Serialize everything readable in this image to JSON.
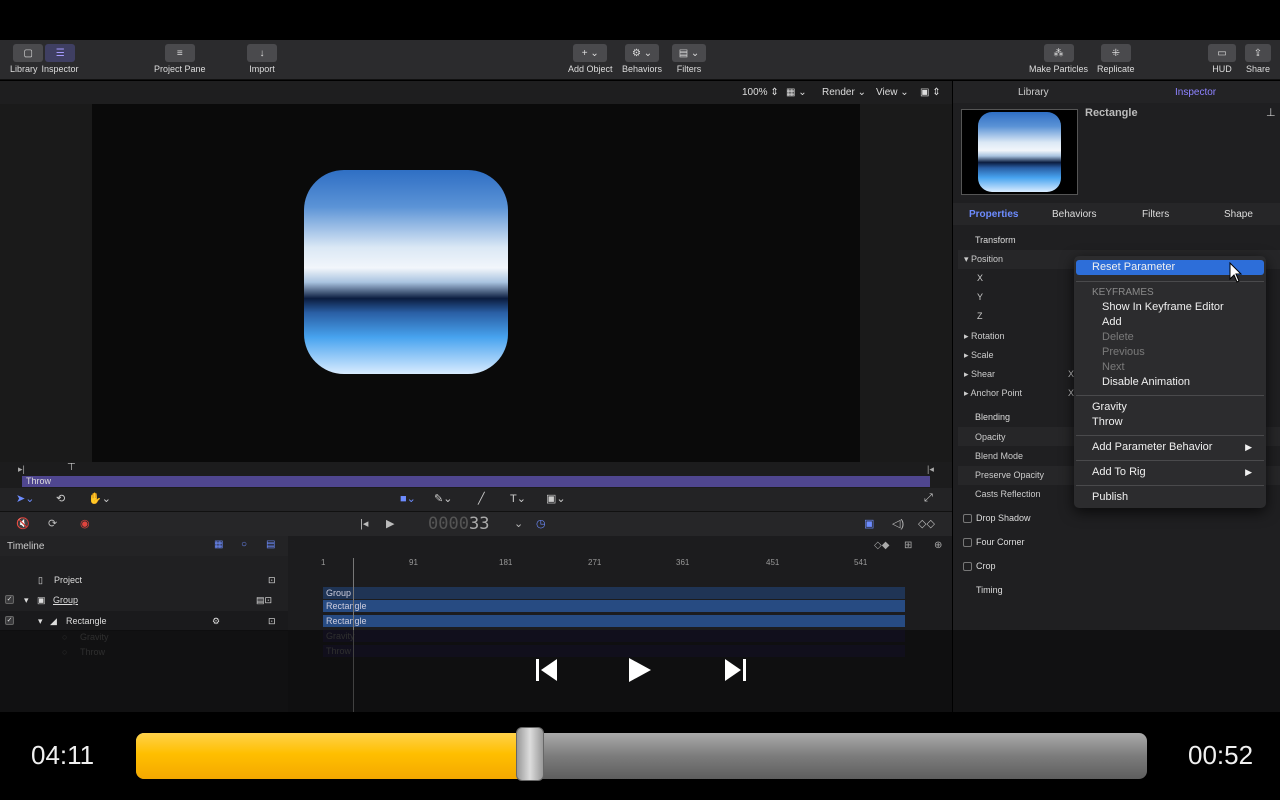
{
  "toolbar": {
    "library": "Library",
    "inspector": "Inspector",
    "project_pane": "Project Pane",
    "import": "Import",
    "add_object": "Add Object",
    "behaviors": "Behaviors",
    "filters": "Filters",
    "make_particles": "Make Particles",
    "replicate": "Replicate",
    "hud": "HUD",
    "share": "Share"
  },
  "viewer": {
    "zoom": "100%",
    "render": "Render",
    "view": "View"
  },
  "mini_timeline": {
    "track_label": "Throw"
  },
  "transport": {
    "frame_prefix": "0000",
    "frame": "33"
  },
  "timeline": {
    "title": "Timeline",
    "layers": [
      {
        "name": "Project"
      },
      {
        "name": "Group"
      },
      {
        "name": "Rectangle"
      },
      {
        "name": "Gravity"
      },
      {
        "name": "Throw"
      }
    ],
    "ruler": [
      "1",
      "91",
      "181",
      "271",
      "361",
      "451",
      "541"
    ],
    "bars": [
      "Group",
      "Rectangle",
      "Rectangle",
      "Gravity",
      "Throw"
    ]
  },
  "right_panel": {
    "tabs": [
      "Library",
      "Inspector"
    ],
    "object_name": "Rectangle",
    "subtabs": [
      "Properties",
      "Behaviors",
      "Filters",
      "Shape"
    ],
    "transform": "Transform",
    "position": "Position",
    "x": "X",
    "y": "Y",
    "z": "Z",
    "rotation": "Rotation",
    "scale": "Scale",
    "shear": "Shear",
    "anchor_point": "Anchor Point",
    "blending": "Blending",
    "opacity": "Opacity",
    "blend_mode": "Blend Mode",
    "preserve_opacity": "Preserve Opacity",
    "casts_reflection": "Casts Reflection",
    "drop_shadow": "Drop Shadow",
    "four_corner": "Four Corner",
    "crop": "Crop",
    "timing": "Timing"
  },
  "context_menu": {
    "reset_parameter": "Reset Parameter",
    "keyframes_header": "KEYFRAMES",
    "show_in_keyframe_editor": "Show In Keyframe Editor",
    "add": "Add",
    "delete": "Delete",
    "previous": "Previous",
    "next": "Next",
    "disable_animation": "Disable Animation",
    "gravity": "Gravity",
    "throw": "Throw",
    "add_parameter_behavior": "Add Parameter Behavior",
    "add_to_rig": "Add To Rig",
    "publish": "Publish"
  },
  "player": {
    "elapsed": "04:11",
    "remaining": "00:52",
    "progress": 0.39
  }
}
